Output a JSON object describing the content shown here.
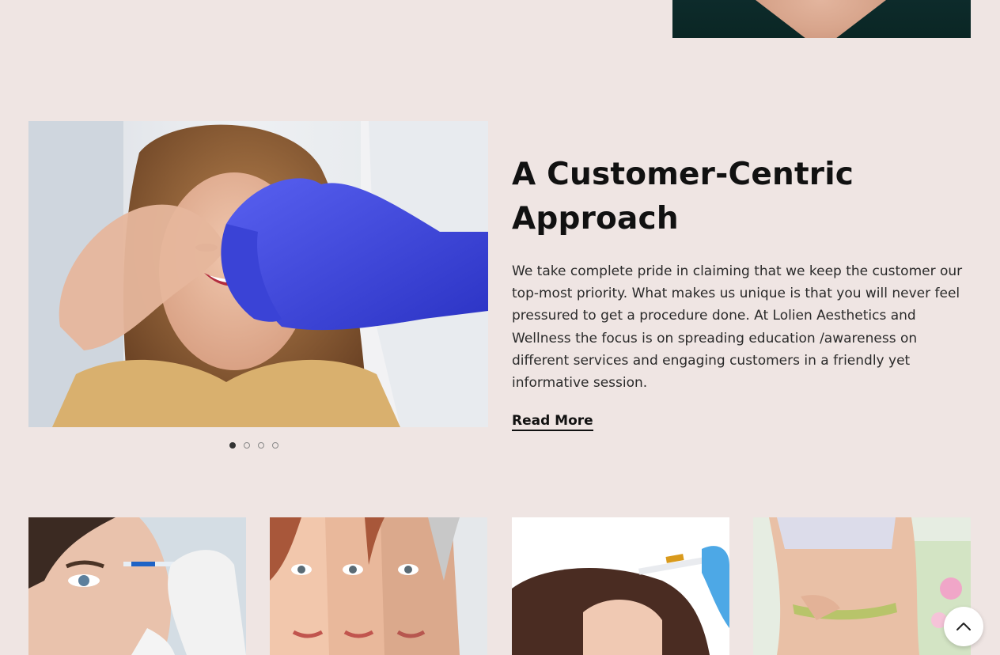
{
  "section": {
    "title": "A Customer-Centric Approach",
    "description": "We take complete pride in claiming that we keep the customer our top-most priority. What makes us unique is that you will never feel pressured to get a procedure done. At Lolien Aesthetics and Wellness the focus is on spreading education /awareness on different services and engaging customers in a friendly yet informative session.",
    "read_more_label": "Read More"
  },
  "carousel": {
    "slide_count": 4,
    "active_index": 0
  },
  "icons": {
    "scroll_top": "chevron-up-icon"
  },
  "colors": {
    "page_background": "#efe5e3",
    "heading": "#111111",
    "body_text": "#2a2a2a",
    "glove_blue": "#3b47d8"
  }
}
